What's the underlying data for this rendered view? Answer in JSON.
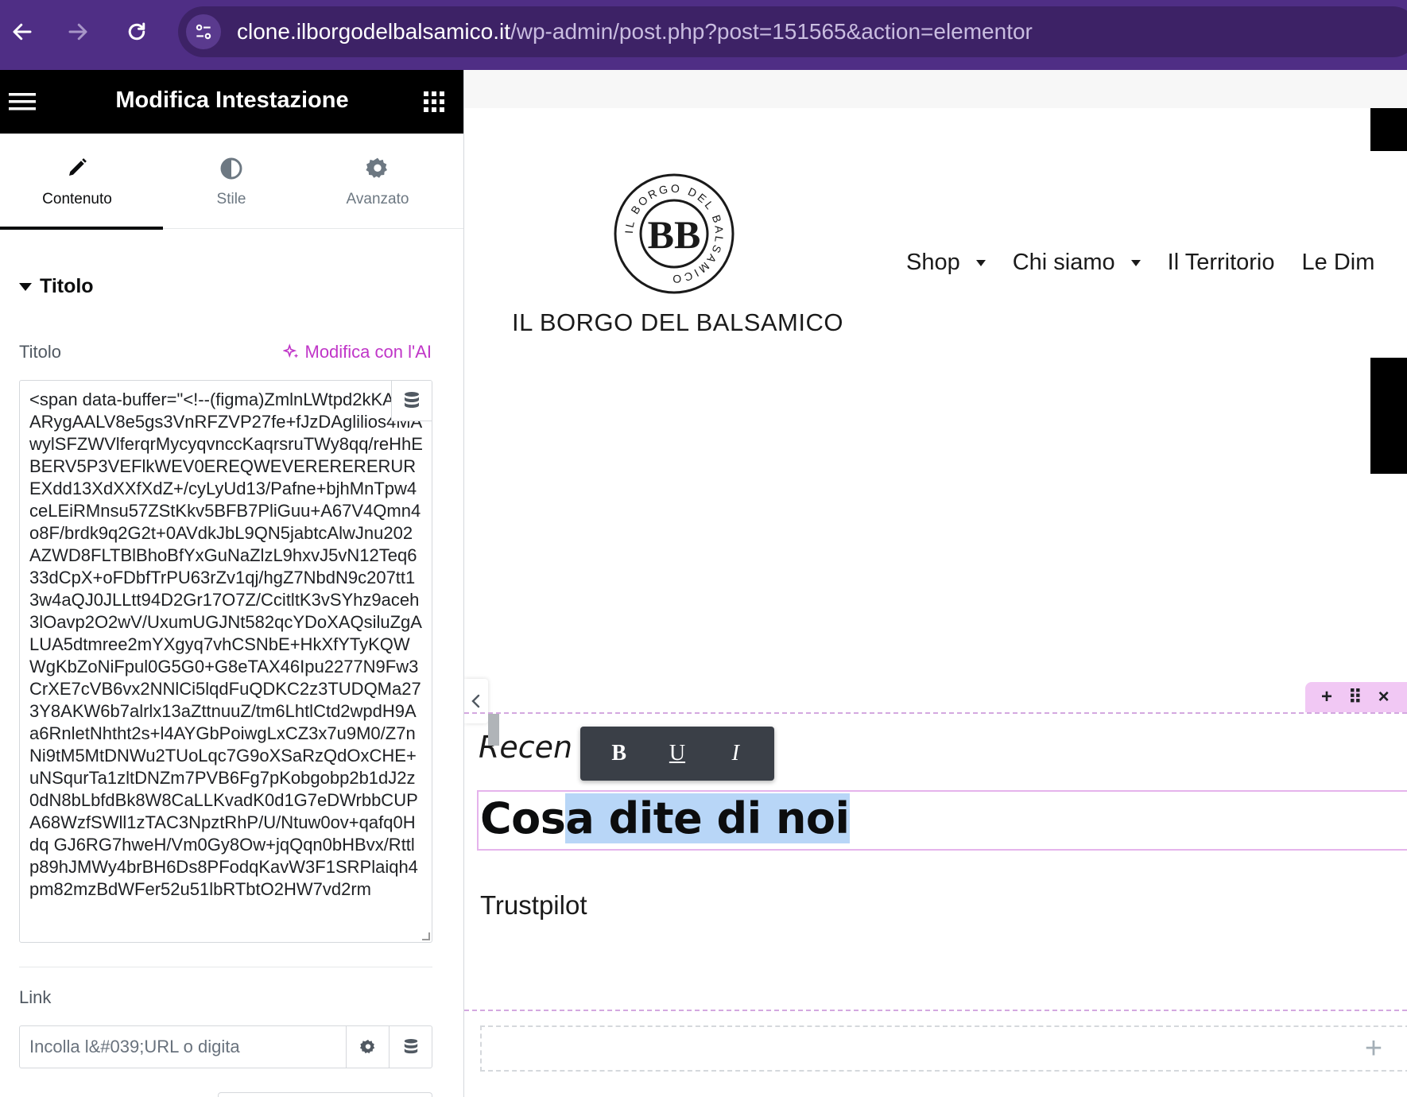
{
  "browser": {
    "url_host": "clone.ilborgodelbalsamico.it",
    "url_path": "/wp-admin/post.php?post=151565&action=elementor"
  },
  "panel": {
    "title": "Modifica Intestazione",
    "tabs": [
      {
        "label": "Contenuto",
        "icon": "pencil-icon",
        "active": true
      },
      {
        "label": "Stile",
        "icon": "contrast-icon",
        "active": false
      },
      {
        "label": "Avanzato",
        "icon": "gear-icon",
        "active": false
      }
    ],
    "section_title": "Titolo",
    "title_field": {
      "label": "Titolo",
      "ai_link": "Modifica con l'AI",
      "value": "<span data-buffer=\"<!--(figma)ZmlnLWtpd2kKAAAARygAALV8e5gs3VnRFZVP27fe+fJzDAglilios4MAwylSFZWVlferqrMycyqvnccKaqrsruTWy8qq/reHhEBERV5P3VEFlkWEV0EREQWEVERERERERUREXdd13XdXXfXdZ+/cyLyUd13/Pafne+bjhMnTpw4ceLEiRMnsu57ZStKkv5BFB7PliGuu+A67V4Qmn4o8F/brdk9q2G2t+0AVdkJbL9QN5jabtcAlwJnu202AZWD8FLTBlBhoBfYxGuNaZlzL9hxvJ5vN12Teq633dCpX+oFDbfTrPU63rZv1qj/hgZ7NbdN9c207tt13w4aQJ0JLLtt94D2Gr17O7Z/CcitltK3vSYhz9aceh3lOavp2O2wV/UxumUGJNt582qcYDoXAQsiluZgALUA5dtmree2mYXgyq7vhCSNbE+HkXfYTyKQWWgKbZoNiFpul0G5G0+G8eTAX46Ipu2277N9Fw3CrXE7cVB6vx2NNlCi5lqdFuQDKC2z3TUDQMa273Y8AKW6b7alrlx13aZttnuuZ/tm6LhtlCtd2wpdH9Aa6RnletNhtht2s+l4AYGbPoiwgLxCZ3x7u9M0/Z7nNi9tM5MtDNWu2TUoLqc7G9oXSaRzQdOxCHE+uNSqurTa1zltDNZm7PVB6Fg7pKobgobp2b1dJ2z0dN8bLbfdBk8W8CaLLKvadK0d1G7eDWrbbCUPA68WzfSWll1zTAC3NpztRhP/U/Ntuw0ov+qafq0Hdq GJ6RG7hweH/Vm0Gy8Ow+jqQqn0bHBvx/Rttlp89hJMWy4brBH6Ds8PFodqKavW3F1SRPlaiqh4pm82mzBdWFer52u51lbRTbtO2HW7vd2rm"
    },
    "link_field": {
      "label": "Link",
      "placeholder": "Incolla l&#039;URL o digita"
    }
  },
  "preview": {
    "brand_name": "IL BORGO DEL BALSAMICO",
    "logo": {
      "monogram": "BB",
      "ring_text": "IL BORGO DEL BALSAMICO"
    },
    "menu": [
      {
        "label": "Shop",
        "has_dropdown": true
      },
      {
        "label": "Chi siamo",
        "has_dropdown": true
      },
      {
        "label": "Il Territorio",
        "has_dropdown": false
      },
      {
        "label": "Le Dim",
        "has_dropdown": false
      }
    ],
    "section_toolbar": {
      "add": "+",
      "move": "⠿",
      "close": "×"
    },
    "recensioni_text": "Recen",
    "format_toolbar": {
      "bold": "B",
      "underline": "U",
      "italic": "I"
    },
    "heading_before_selection": "Cos",
    "heading_selected": "a dite di noi",
    "subheading": "Trustpilot",
    "add_plus": "+"
  },
  "colors": {
    "browser_bar": "#4f2e85",
    "ai_accent": "#c036c8",
    "selection": "#b8d6f7",
    "elementor_frame": "#e5b3ec"
  }
}
